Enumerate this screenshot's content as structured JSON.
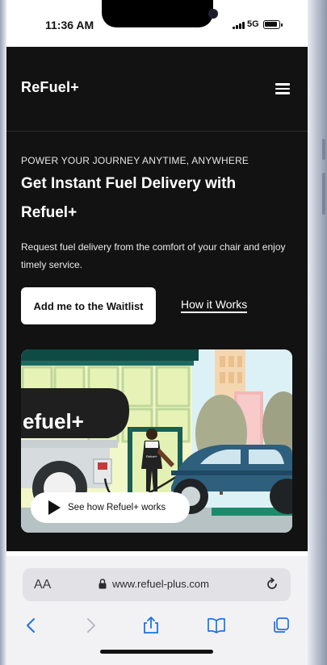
{
  "status_bar": {
    "time": "11:36 AM",
    "network": "5G"
  },
  "nav": {
    "logo": "ReFuel+",
    "menu_icon": "hamburger-menu-icon"
  },
  "hero_text": {
    "eyebrow": "POWER YOUR JOURNEY ANYTIME, ANYWHERE",
    "headline": "Get Instant Fuel Delivery with Refuel+",
    "description": "Request fuel delivery from the comfort of your chair and enjoy timely service."
  },
  "actions": {
    "waitlist_label": "Add me to the Waitlist",
    "how_label": "How it Works"
  },
  "hero_image": {
    "tank_text": "efuel+",
    "attendant_badge": "Refuel+",
    "play_label": "See how Refuel+ works"
  },
  "safari": {
    "aa_label": "AA",
    "url": "www.refuel-plus.com"
  },
  "colors": {
    "background": "#121212",
    "accent": "#ffffff",
    "safari_bar": "#f2f2f4",
    "link_blue": "#1a73e8"
  }
}
